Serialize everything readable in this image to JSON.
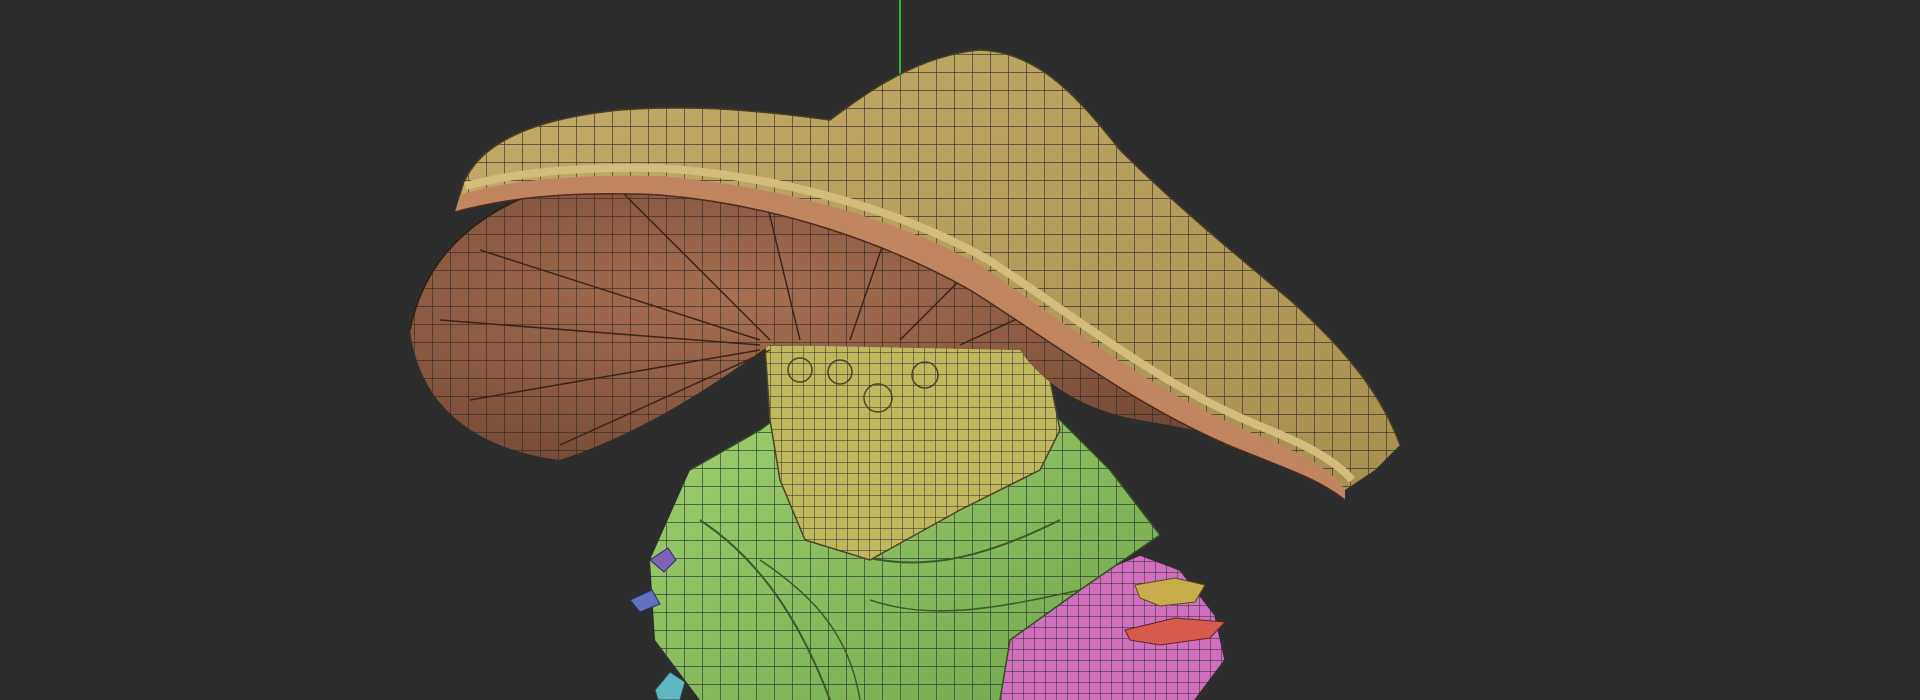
{
  "viewport": {
    "background": "#2d2d2d",
    "grid_overlay": true,
    "gizmo_axis_color": "#2fb52f"
  },
  "model": {
    "polygroup_colors": {
      "cap_top": "#b9a15e",
      "cap_rim_band": "#c1855f",
      "cap_rim_light": "#d3bd7c",
      "cap_underside": "#8e5b42",
      "stem": "#c0b85f",
      "body": "#8fc261",
      "collar": "#cf6fbe",
      "flower_yellow": "#c9ac4b",
      "flower_red": "#d85a4f",
      "flower_purple": "#7060b8",
      "flower_cyan": "#5fb7c2"
    },
    "icons": [
      "wireframe-mesh-icon",
      "transform-gizmo-icon"
    ]
  }
}
